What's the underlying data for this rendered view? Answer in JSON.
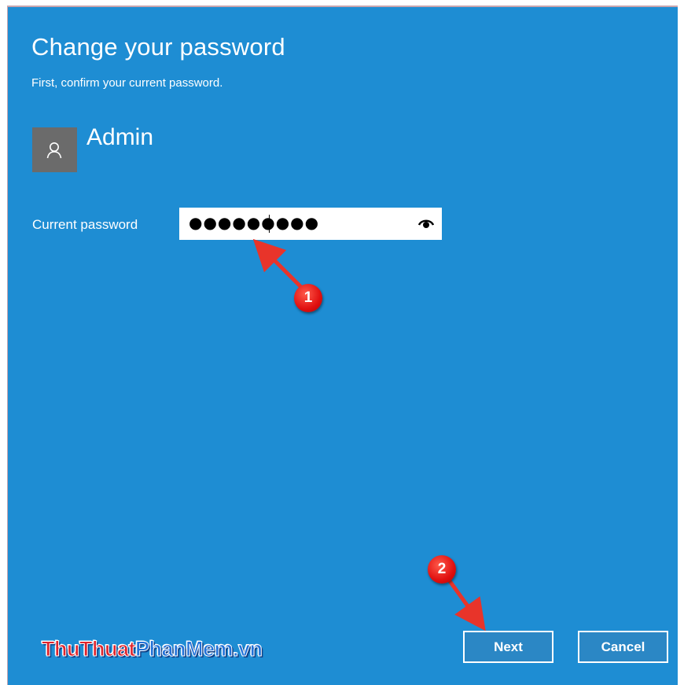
{
  "dialog": {
    "title": "Change your password",
    "subtitle": "First, confirm your current password."
  },
  "account": {
    "name": "Admin",
    "avatar_icon": "user-icon"
  },
  "password": {
    "label": "Current password",
    "masked_value": "●●●●●●●●●",
    "reveal_icon": "eye-icon"
  },
  "buttons": {
    "next": "Next",
    "cancel": "Cancel"
  },
  "annotations": {
    "step_1": "1",
    "step_2": "2"
  },
  "watermark": {
    "part_1": "ThuThuat",
    "part_2": "PhanMem.vn"
  },
  "colors": {
    "background": "#1e8dd3",
    "avatar": "#6b6b6b",
    "marker": "#e01010"
  }
}
